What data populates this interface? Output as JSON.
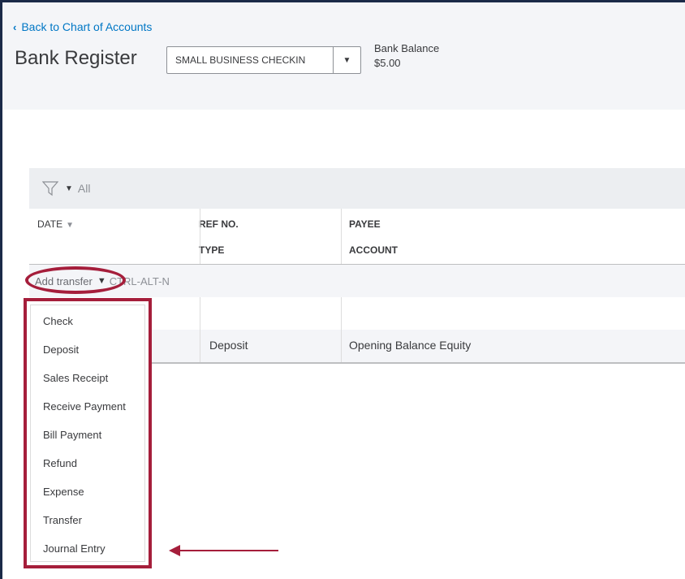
{
  "header": {
    "back_link": "Back to Chart of Accounts",
    "title": "Bank Register",
    "account_select_value": "SMALL BUSINESS CHECKIN",
    "bank_balance_label": "Bank Balance",
    "bank_balance_value": "$5.00"
  },
  "filter": {
    "label": "All"
  },
  "columns": {
    "date": "DATE",
    "ref_no": "REF NO.",
    "type": "TYPE",
    "payee": "PAYEE",
    "account": "ACCOUNT"
  },
  "add_row": {
    "label": "Add transfer",
    "shortcut": "CTRL-ALT-N"
  },
  "rows": [
    {
      "type": "Deposit",
      "account": "Opening Balance Equity"
    }
  ],
  "menu": {
    "items": [
      "Check",
      "Deposit",
      "Sales Receipt",
      "Receive Payment",
      "Bill Payment",
      "Refund",
      "Expense",
      "Transfer",
      "Journal Entry"
    ]
  },
  "colors": {
    "highlight": "#a51e3b",
    "link": "#0077c5",
    "navy_border": "#1b2a48"
  },
  "icons": [
    "chevron-left-icon",
    "dropdown-arrow-icon",
    "filter-funnel-icon",
    "sort-down-icon",
    "red-arrow-pointer-icon"
  ]
}
